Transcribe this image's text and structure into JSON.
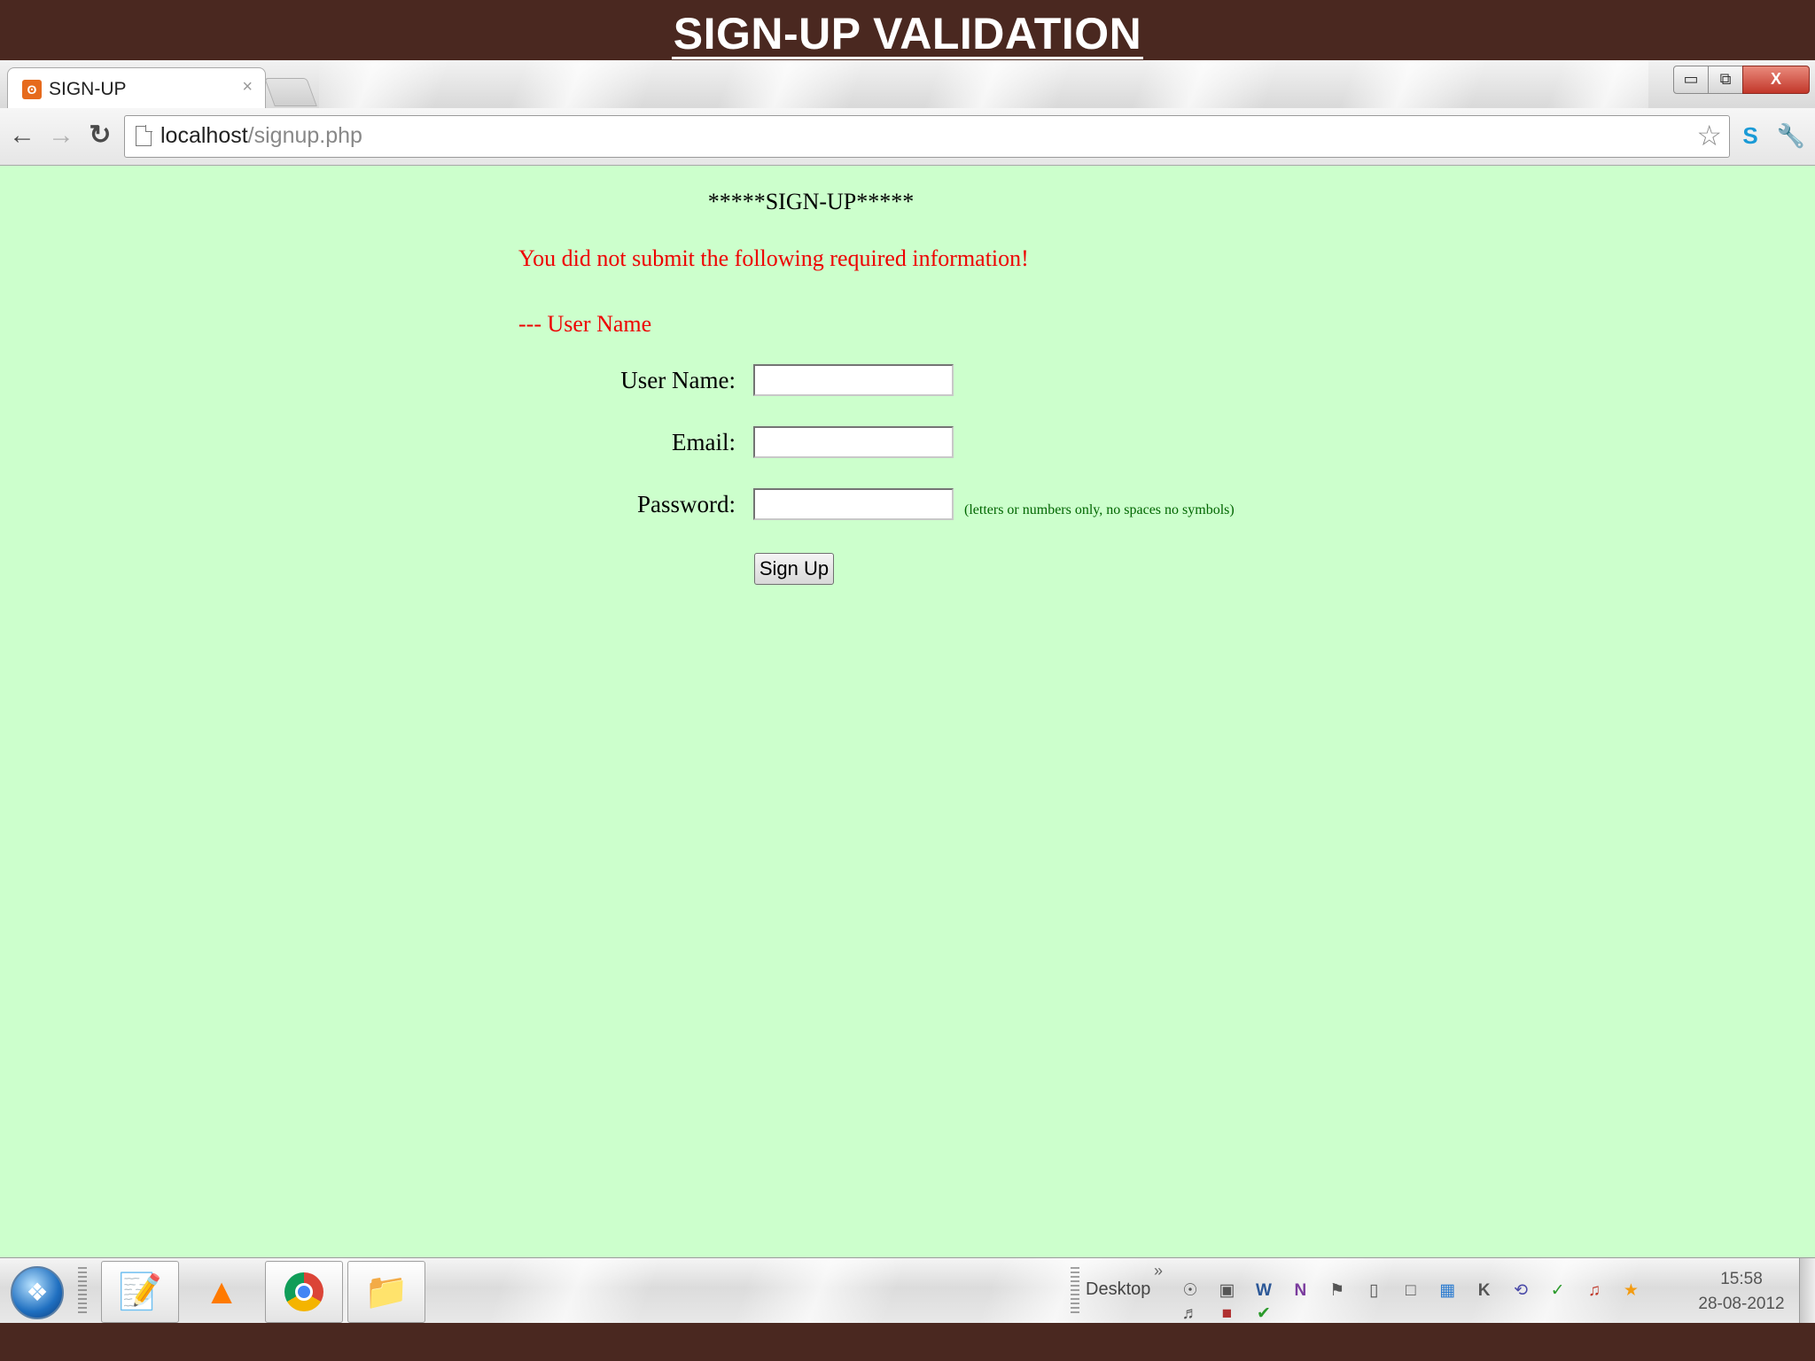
{
  "slide": {
    "title": "SIGN-UP VALIDATION"
  },
  "browser": {
    "tab_title": "SIGN-UP",
    "tab_close": "×",
    "url_host": "localhost",
    "url_path": "/signup.php",
    "window_min": "▭",
    "window_max": "⧉",
    "window_close": "X",
    "icons": [
      "back-icon",
      "forward-icon",
      "reload-icon",
      "page-icon",
      "star-icon",
      "skype-icon",
      "wrench-icon"
    ]
  },
  "page": {
    "heading": "*****SIGN-UP*****",
    "error": "You did not submit the following required information!",
    "missing_field": "--- User Name",
    "labels": {
      "username": "User Name:",
      "email": "Email:",
      "password": "Password:"
    },
    "values": {
      "username": "",
      "email": "",
      "password": ""
    },
    "password_hint": "(letters or numbers only, no spaces no symbols)",
    "submit": "Sign Up",
    "background": "#ccffcc",
    "error_color": "#ee0000"
  },
  "taskbar": {
    "desktop_label": "Desktop",
    "desktop_chevron": "»",
    "pinned": [
      "notepad-icon",
      "vlc-icon",
      "chrome-icon",
      "explorer-icon"
    ],
    "time": "15:58",
    "date": "28-08-2012"
  },
  "colors": {
    "slide_band": "#4a2820"
  }
}
